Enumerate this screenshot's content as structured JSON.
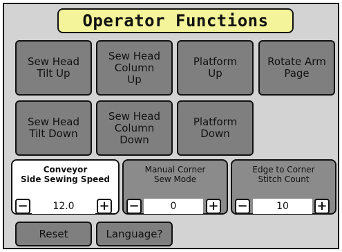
{
  "title": "Operator Functions",
  "buttons": {
    "sew_head_tilt_up": "Sew Head\nTilt Up",
    "sew_head_column_up": "Sew Head\nColumn\nUp",
    "platform_up": "Platform\nUp",
    "rotate_arm_page": "Rotate Arm\nPage",
    "sew_head_tilt_down": "Sew Head\nTilt Down",
    "sew_head_column_down": "Sew Head\nColumn\nDown",
    "platform_down": "Platform\nDown",
    "reset": "Reset",
    "language": "Language?"
  },
  "settings": [
    {
      "label": "Conveyor\nSide Sewing Speed",
      "value": "12.0",
      "minus": "−",
      "plus": "+"
    },
    {
      "label": "Manual Corner\nSew Mode",
      "value": "0",
      "minus": "−",
      "plus": "+"
    },
    {
      "label": "Edge to Corner\nStitch Count",
      "value": "10",
      "minus": "−",
      "plus": "+"
    }
  ],
  "colors": {
    "panel": "#d3d3d3",
    "title_bg": "#f4f59a",
    "button": "#7f7f7f"
  }
}
